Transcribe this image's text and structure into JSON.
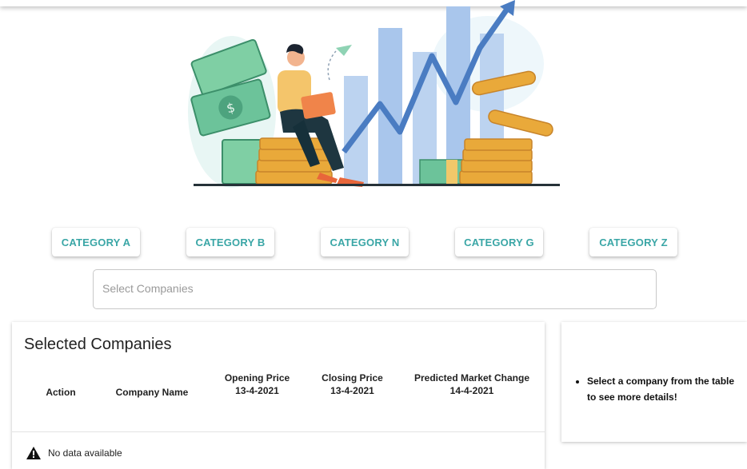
{
  "categories": [
    "CATEGORY A",
    "CATEGORY B",
    "CATEGORY N",
    "CATEGORY G",
    "CATEGORY Z"
  ],
  "select": {
    "placeholder": "Select Companies"
  },
  "table": {
    "title": "Selected Companies",
    "columns": {
      "action": "Action",
      "company_name": "Company Name",
      "opening_title": "Opening Price",
      "opening_date": "13-4-2021",
      "closing_title": "Closing Price",
      "closing_date": "13-4-2021",
      "predicted_title": "Predicted Market Change",
      "predicted_date": "14-4-2021"
    },
    "empty_text": "No data available"
  },
  "side_panel": {
    "message": "Select a company from the table to see more details!"
  },
  "colors": {
    "accent": "#3aa6a6",
    "chart_line": "#4a7cc2",
    "coin": "#e9a93a",
    "money": "#6cc39a"
  },
  "icons": {
    "warning": "warning-icon",
    "hero": "finance-illustration"
  }
}
